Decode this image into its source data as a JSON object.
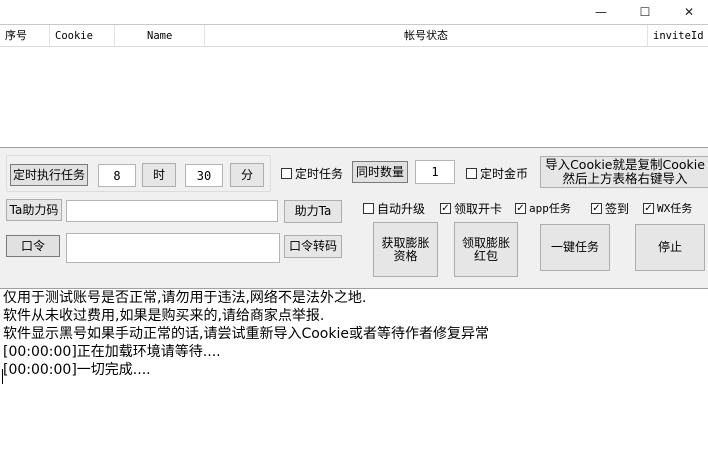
{
  "window": {
    "minimize_icon": "—",
    "maximize_icon": "☐",
    "close_icon": "✕"
  },
  "grid": {
    "columns": [
      "序号",
      "Cookie",
      "Name",
      "帐号状态",
      "inviteId"
    ],
    "rows": []
  },
  "controls": {
    "timed_exec_button": "定时执行任务",
    "hour_value": "8",
    "hour_button": "时",
    "minute_value": "30",
    "minute_button": "分",
    "timed_task_check": {
      "label": "定时任务",
      "checked": false
    },
    "concurrent_button": "同时数量",
    "concurrent_value": "1",
    "timed_coin_check": {
      "label": "定时金币",
      "checked": false
    },
    "import_cookie_button": "导入Cookie就是复制Cookie然后上方表格右键导入",
    "ta_code_button": "Ta助力码",
    "ta_code_value": "",
    "help_ta_button": "助力Ta",
    "auto_upgrade_check": {
      "label": "自动升级",
      "checked": false
    },
    "open_card_check": {
      "label": "领取开卡",
      "checked": true
    },
    "app_task_check": {
      "label": "app任务",
      "checked": true
    },
    "signin_check": {
      "label": "签到",
      "checked": true
    },
    "wx_task_check": {
      "label": "WX任务",
      "checked": true
    },
    "password_button": "口令",
    "password_value": "",
    "password_convert_button": "口令转码",
    "get_swell_button": "获取膨胀资格",
    "claim_swell_button": "领取膨胀红包",
    "one_click_button": "一键任务",
    "stop_button": "停止"
  },
  "log": {
    "lines": [
      "仅用于测试账号是否正常,请勿用于违法,网络不是法外之地.",
      "软件从未收过费用,如果是购买来的,请给商家点举报.",
      "软件显示黑号如果手动正常的话,请尝试重新导入Cookie或者等待作者修复异常",
      "[00:00:00]正在加载环境请等待....",
      "[00:00:00]一切完成...."
    ]
  }
}
